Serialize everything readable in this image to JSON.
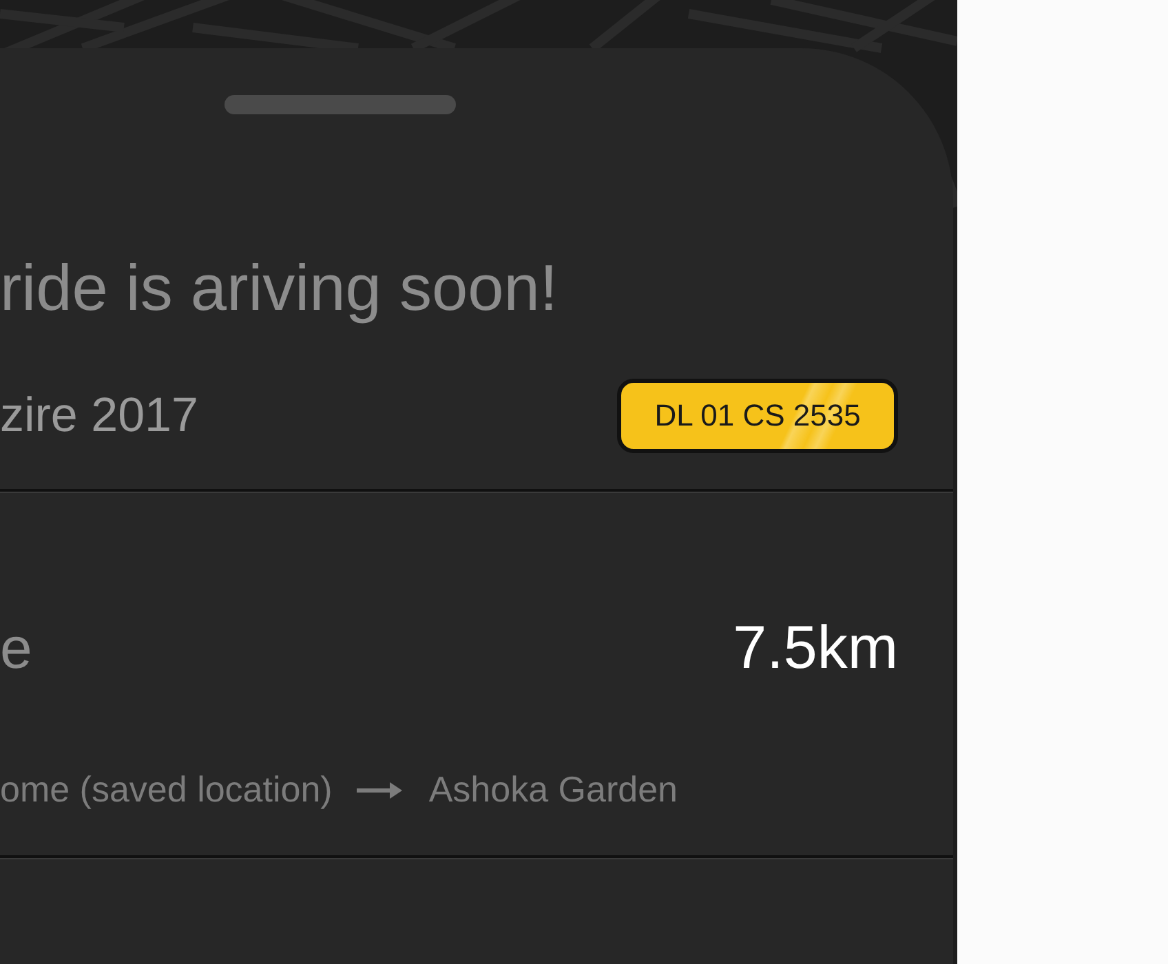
{
  "sheet": {
    "title": "ride is ariving soon!",
    "car": "zire 2017",
    "plate": "DL 01 CS 2535",
    "distance_label": "e",
    "distance": "7.5km",
    "route": {
      "from": "ome (saved location)",
      "to": "Ashoka Garden"
    }
  }
}
